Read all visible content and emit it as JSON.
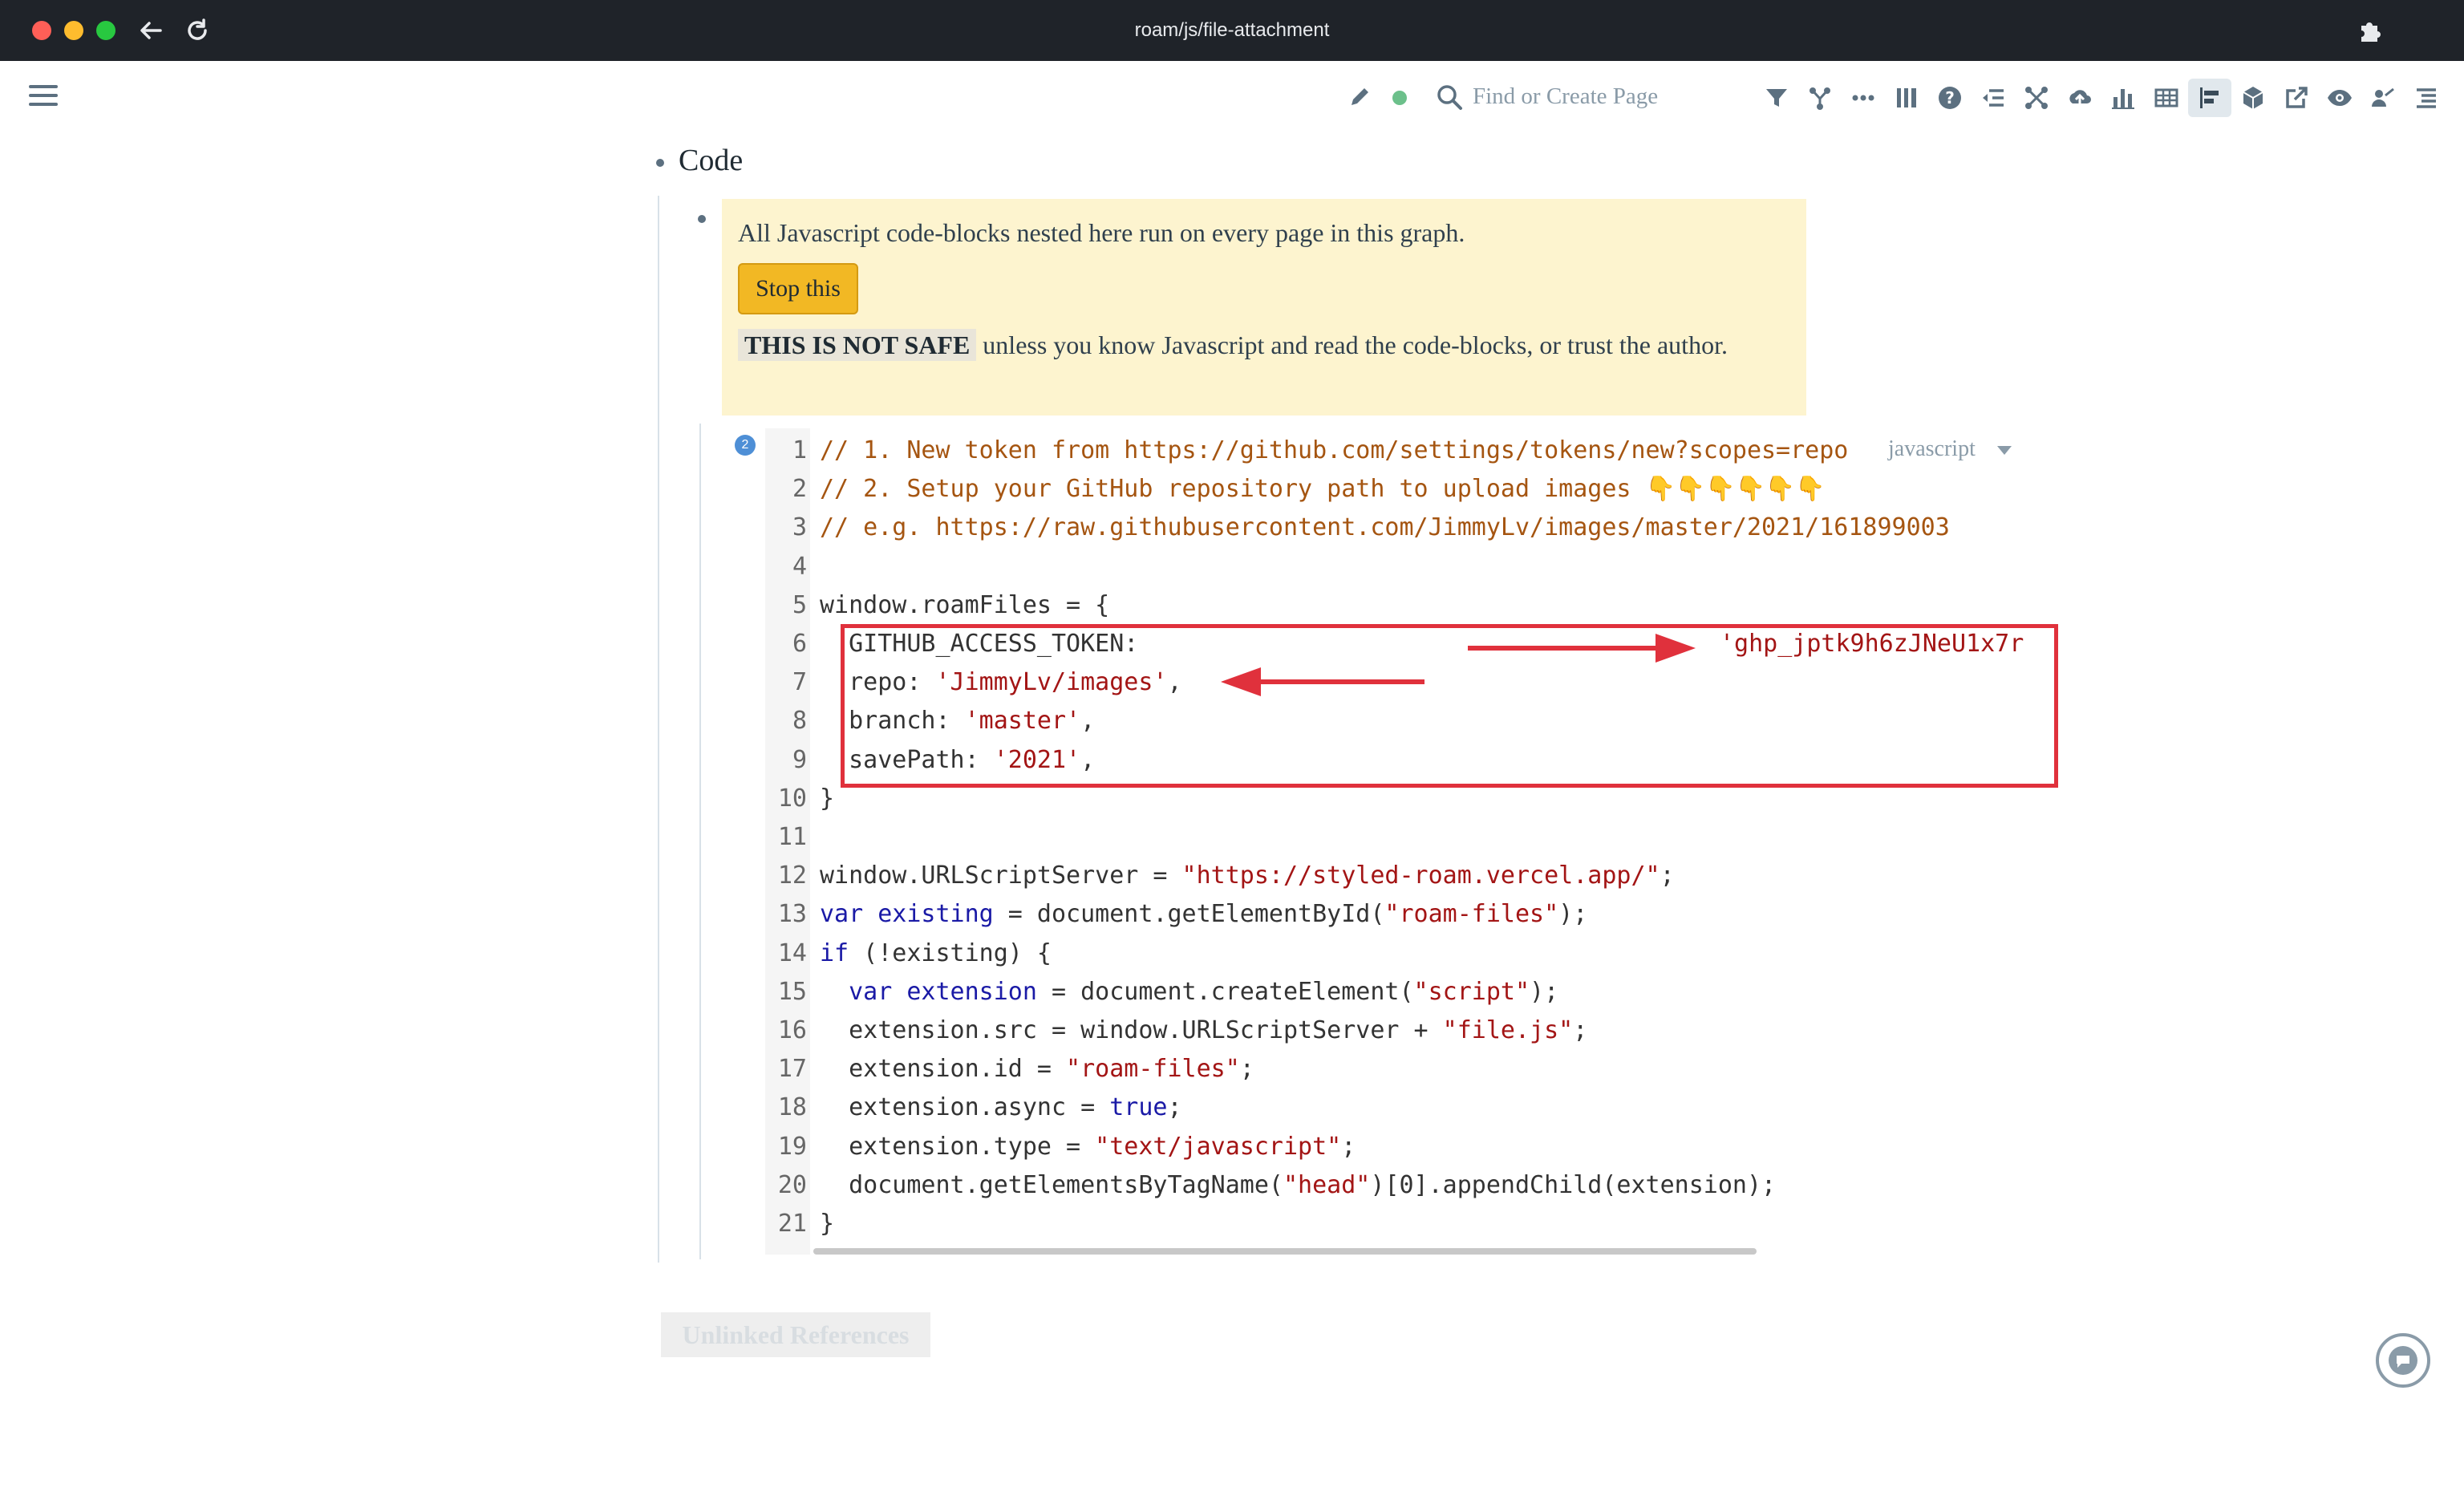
{
  "window": {
    "title": "roam/js/file-attachment",
    "icons": [
      "back-arrow-icon",
      "reload-icon",
      "extensions-puzzle-icon"
    ]
  },
  "topbar": {
    "search_placeholder": "Find or Create Page",
    "sync_color": "#6cc08b"
  },
  "page": {
    "block_title": "Code",
    "warning": {
      "line1": "All Javascript code-blocks nested here run on every page in this graph.",
      "button": "Stop this",
      "not_safe": "THIS IS NOT SAFE",
      "rest": " unless you know Javascript and read the code-blocks, or trust the author."
    },
    "code_block": {
      "badge": "2",
      "language": "javascript",
      "line_numbers": [
        "1",
        "2",
        "3",
        "4",
        "5",
        "6",
        "7",
        "8",
        "9",
        "10",
        "11",
        "12",
        "13",
        "14",
        "15",
        "16",
        "17",
        "18",
        "19",
        "20",
        "21"
      ],
      "lines": [
        "// 1. New token from https://github.com/settings/tokens/new?scopes=repo",
        "// 2. Setup your GitHub repository path to upload images 👇👇👇👇👇👇",
        "// e.g. https://raw.githubusercontent.com/JimmyLv/images/master/2021/161899003",
        "",
        "window.roamFiles = {",
        "  GITHUB_ACCESS_TOKEN:",
        "  repo: 'JimmyLv/images',",
        "  branch: 'master',",
        "  savePath: '2021',",
        "}",
        "",
        "window.URLScriptServer = \"https://styled-roam.vercel.app/\";",
        "var existing = document.getElementById(\"roam-files\");",
        "if (!existing) {",
        "  var extension = document.createElement(\"script\");",
        "  extension.src = window.URLScriptServer + \"file.js\";",
        "  extension.id = \"roam-files\";",
        "  extension.async = true;",
        "  extension.type = \"text/javascript\";",
        "  document.getElementsByTagName(\"head\")[0].appendChild(extension);",
        "}"
      ],
      "token_value": "'ghp_jptk9h6zJNeU1x7r"
    },
    "unlinked_references": "Unlinked References",
    "accent_red": "#e0313c"
  }
}
